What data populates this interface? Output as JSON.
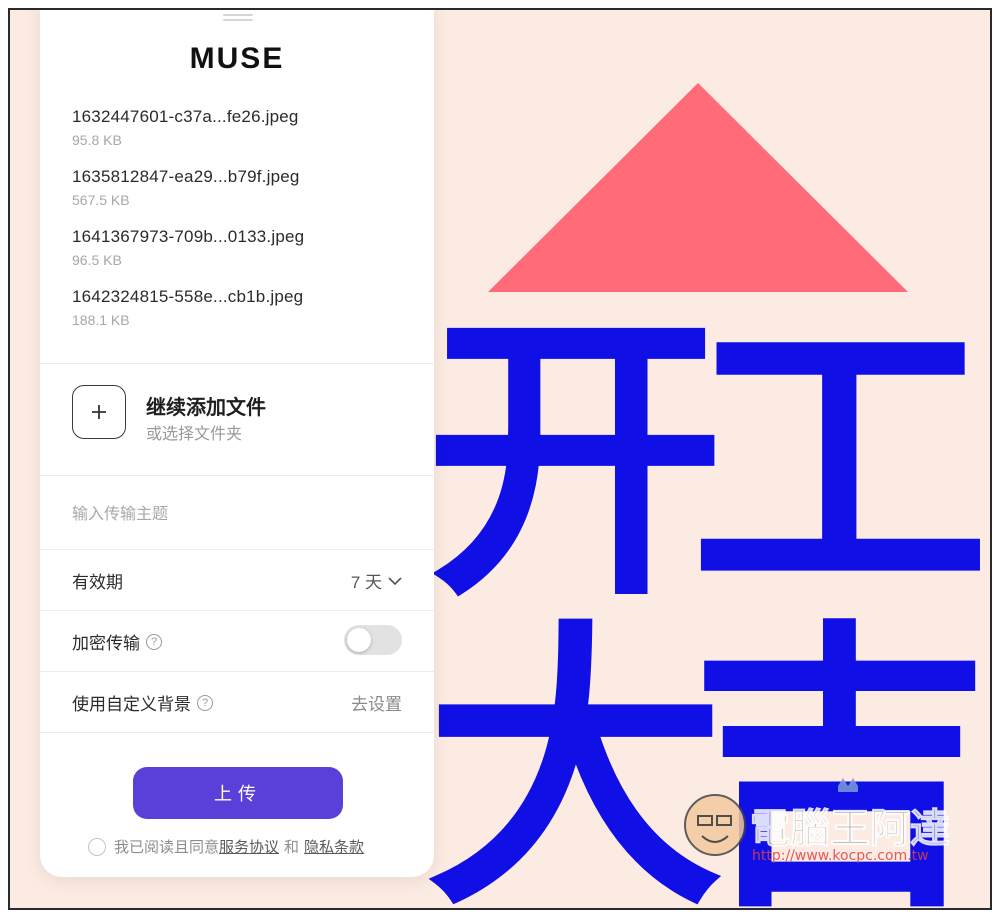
{
  "app": {
    "brand": "MUSE"
  },
  "files": [
    {
      "name": "1632447601-c37a...fe26.jpeg",
      "size": "95.8 KB"
    },
    {
      "name": "1635812847-ea29...b79f.jpeg",
      "size": "567.5 KB"
    },
    {
      "name": "1641367973-709b...0133.jpeg",
      "size": "96.5 KB"
    },
    {
      "name": "1642324815-558e...cb1b.jpeg",
      "size": "188.1 KB"
    }
  ],
  "add_files": {
    "title": "继续添加文件",
    "subtitle": "或选择文件夹",
    "icon": "plus-icon"
  },
  "subject": {
    "placeholder": "输入传输主题"
  },
  "expiry": {
    "label": "有效期",
    "value": "7 天",
    "icon": "chevron-down-icon"
  },
  "encrypt": {
    "label": "加密传输",
    "help_icon": "question-circle-icon",
    "enabled": false
  },
  "background": {
    "label": "使用自定义背景",
    "help_icon": "question-circle-icon",
    "action": "去设置"
  },
  "upload_button": {
    "label": "上传"
  },
  "agreement": {
    "prefix": "我已阅读且同意",
    "terms_link": "服务协议",
    "conjunction": "和",
    "privacy_link": "隐私条款",
    "checked": false
  },
  "background_art": {
    "characters": [
      "开",
      "工",
      "大",
      "吉"
    ],
    "triangle_color": "#ff6b78",
    "character_color": "#1010e6",
    "background_color": "#fbebe2"
  },
  "watermark": {
    "text": "電腦王阿達",
    "url": "http://www.kocpc.com.tw"
  }
}
